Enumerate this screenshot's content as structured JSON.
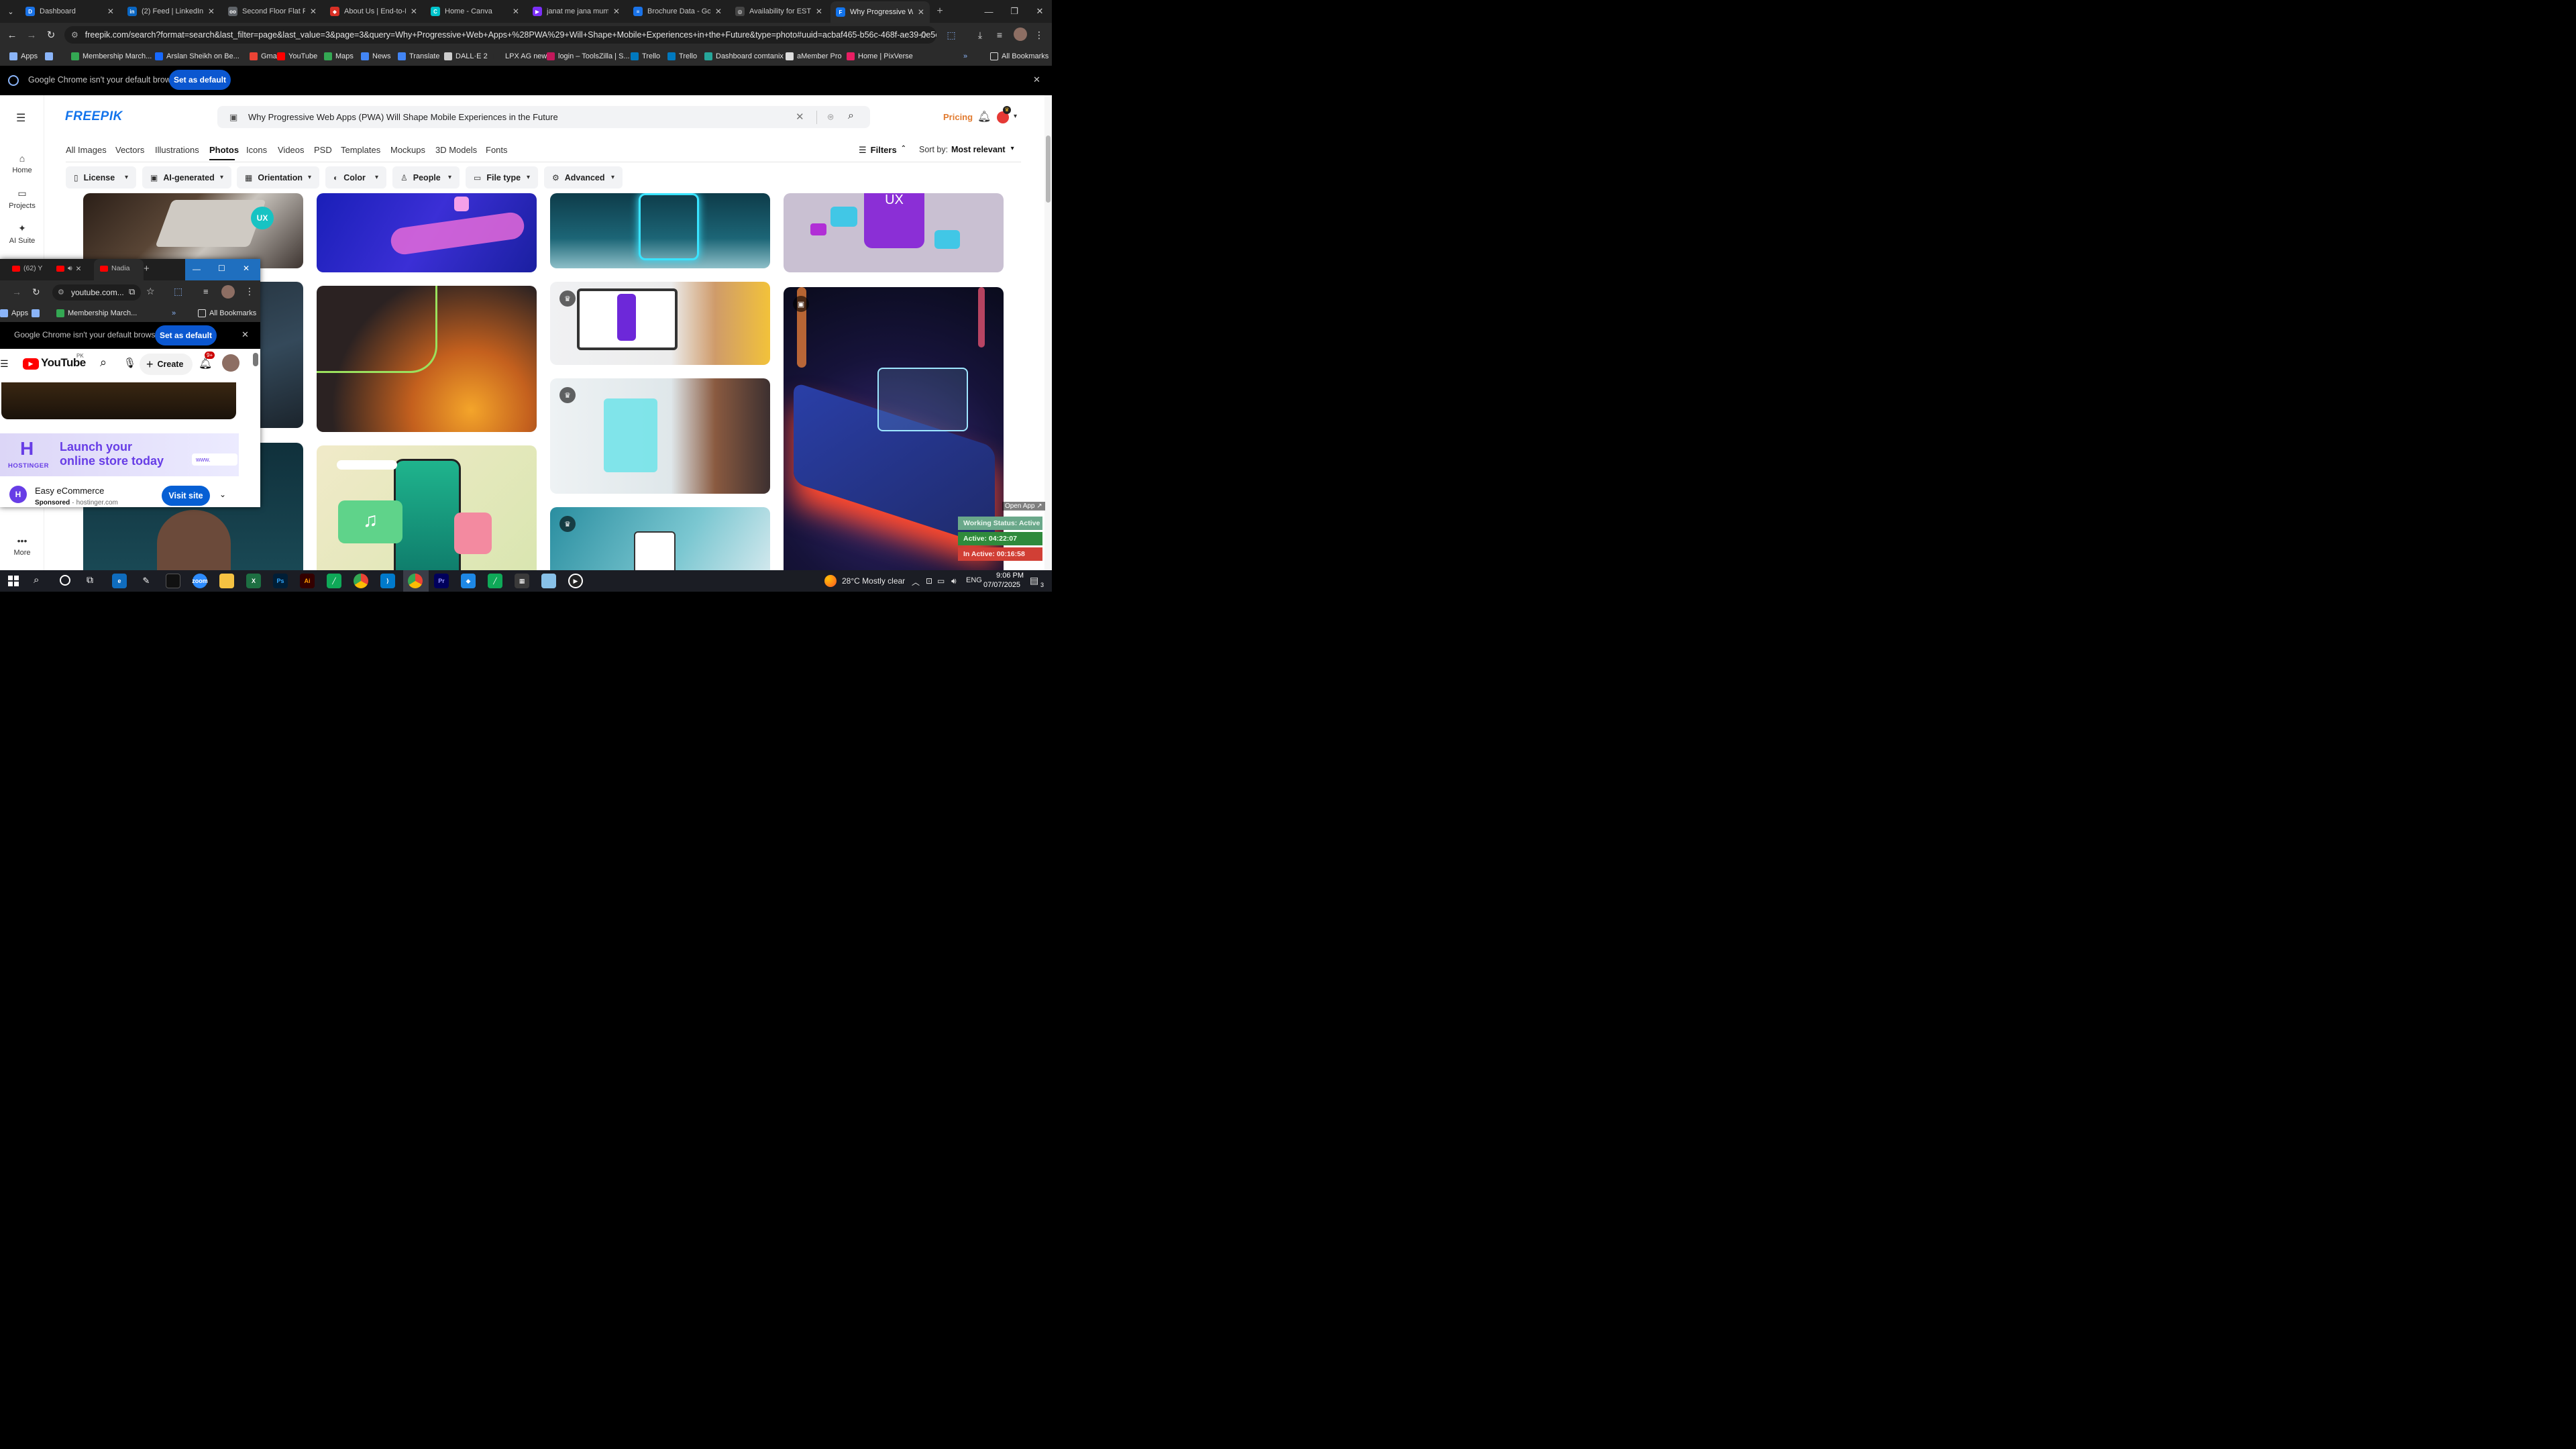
{
  "browser": {
    "tabs": [
      {
        "title": "Dashboard",
        "color": "#1a73e8",
        "glyph": "D"
      },
      {
        "title": "(2) Feed | LinkedIn",
        "color": "#0a66c2",
        "glyph": "in"
      },
      {
        "title": "Second Floor Flat For",
        "color": "#5f6368",
        "glyph": "oo"
      },
      {
        "title": "About Us | End-to-End",
        "color": "#d93025",
        "glyph": "◆"
      },
      {
        "title": "Home - Canva",
        "color": "#00c4cc",
        "glyph": "C"
      },
      {
        "title": "janat me jana mumki",
        "color": "#7b2ff7",
        "glyph": "▶"
      },
      {
        "title": "Brochure Data - Goo",
        "color": "#1a73e8",
        "glyph": "≡"
      },
      {
        "title": "Availability for EST sh",
        "color": "#444444",
        "glyph": "◎"
      },
      {
        "title": "Why Progressive Web",
        "color": "#1273eb",
        "glyph": "F"
      }
    ],
    "url": "freepik.com/search?format=search&last_filter=page&last_value=3&page=3&query=Why+Progressive+Web+Apps+%28PWA%29+Will+Shape+Mobile+Experiences+in+the+Future&type=photo#uuid=acbaf465-b56c-468f-ae39-0e5ce401c466",
    "bookmarks": [
      {
        "label": "Apps",
        "color": "#8ab4f8"
      },
      {
        "label": "",
        "color": "#8ab4f8"
      },
      {
        "label": "Membership March...",
        "color": "#34a853"
      },
      {
        "label": "Arslan Sheikh on Be...",
        "color": "#1769ff"
      },
      {
        "label": "Gmail",
        "color": "#ea4335"
      },
      {
        "label": "YouTube",
        "color": "#ff0000"
      },
      {
        "label": "Maps",
        "color": "#34a853"
      },
      {
        "label": "News",
        "color": "#4285f4"
      },
      {
        "label": "Translate",
        "color": "#4285f4"
      },
      {
        "label": "DALL·E 2",
        "color": "#cccccc"
      },
      {
        "label": "LPX AG new",
        "color": "#2b2b2b"
      },
      {
        "label": "login – ToolsZilla | S...",
        "color": "#c2185b"
      },
      {
        "label": "Trello",
        "color": "#0079bf"
      },
      {
        "label": "Trello",
        "color": "#0079bf"
      },
      {
        "label": "Dashboard comtanix",
        "color": "#26a69a"
      },
      {
        "label": "aMember Pro",
        "color": "#dddddd"
      },
      {
        "label": "Home | PixVerse",
        "color": "#e91e63"
      }
    ],
    "all_bookmarks": "All Bookmarks",
    "infobar_msg": "Google Chrome isn't your default browser",
    "set_default": "Set as default"
  },
  "freepik": {
    "logo": "FREEPIK",
    "search_query": "Why Progressive Web Apps (PWA) Will Shape Mobile Experiences in the Future",
    "pricing": "Pricing",
    "sidebar": [
      {
        "label": "Home",
        "icon": "⌂"
      },
      {
        "label": "Projects",
        "icon": "▭"
      },
      {
        "label": "AI Suite",
        "icon": "✦"
      },
      {
        "label": "More",
        "icon": "•••"
      }
    ],
    "categories": [
      "All Images",
      "Vectors",
      "Illustrations",
      "Photos",
      "Icons",
      "Videos",
      "PSD",
      "Templates",
      "Mockups",
      "3D Models",
      "Fonts"
    ],
    "active_category": "Photos",
    "filters_label": "Filters",
    "sort_label": "Sort by:",
    "sort_value": "Most relevant",
    "filter_buttons": [
      {
        "label": "License",
        "icon": "▯"
      },
      {
        "label": "AI-generated",
        "icon": "▣"
      },
      {
        "label": "Orientation",
        "icon": "▦"
      },
      {
        "label": "Color",
        "icon": "◐"
      },
      {
        "label": "People",
        "icon": "♙"
      },
      {
        "label": "File type",
        "icon": "▭"
      },
      {
        "label": "Advanced",
        "icon": "⚙"
      }
    ]
  },
  "youtube_window": {
    "tabs": [
      "(62) Y",
      "Nadia"
    ],
    "url": "youtube.com...",
    "bookmarks": [
      "Apps",
      "Membership March..."
    ],
    "all_bookmarks": "All Bookmarks",
    "infobar_msg": "Google Chrome isn't your default browser",
    "set_default": "Set as default",
    "logo": "YouTube",
    "country": "PK",
    "create": "Create",
    "notif_count": "9+",
    "ad_brand": "HOSTINGER",
    "ad_headline_1": "Launch your",
    "ad_headline_2": "online store today",
    "ad_url_chip": "www.",
    "ad_title": "Easy eCommerce",
    "ad_sponsored": "Sponsored",
    "ad_domain": "hostinger.com",
    "ad_cta": "Visit site"
  },
  "status_overlay": {
    "open_app": "Open App ↗",
    "working": "Working Status: Active",
    "active": "Active: 04:22:07",
    "inactive": "In Active: 00:16:58"
  },
  "taskbar": {
    "weather": "28°C  Mostly clear",
    "lang": "ENG",
    "time": "9:06 PM",
    "date": "07/07/2025",
    "notif_count": "3"
  }
}
